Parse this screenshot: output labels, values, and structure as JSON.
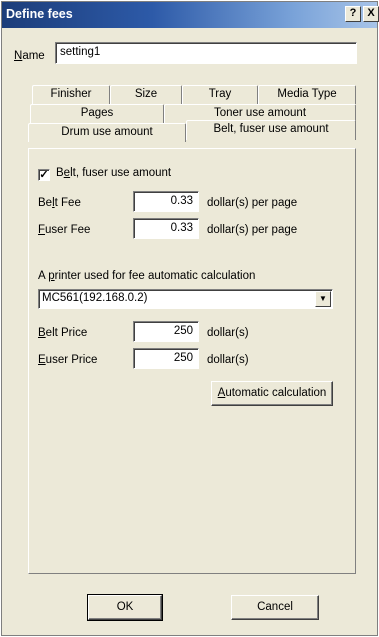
{
  "window": {
    "title": "Define fees",
    "help_label": "?",
    "close_label": "X"
  },
  "name_field": {
    "label_mnemonic": "N",
    "label_rest": "ame",
    "value": "setting1"
  },
  "tabs": {
    "row1": [
      "Finisher",
      "Size",
      "Tray",
      "Media Type"
    ],
    "row2": [
      "Pages",
      "Toner use amount"
    ],
    "row3": [
      "Drum use amount",
      "Belt, fuser use amount"
    ]
  },
  "belt_fuser": {
    "checkbox": {
      "checked_glyph": "✓",
      "mnemonic": "e",
      "pre": "B",
      "rest": "lt, fuser use amount"
    },
    "belt_fee": {
      "pre": "Be",
      "mnemonic": "l",
      "rest": "t Fee",
      "value": "0.33",
      "unit": "dollar(s) per page"
    },
    "fuser_fee": {
      "pre": "",
      "mnemonic": "F",
      "rest": "user Fee",
      "value": "0.33",
      "unit": "dollar(s) per page"
    },
    "printer_label": {
      "pre": "A ",
      "mnemonic": "p",
      "rest": "rinter used for fee automatic calculation"
    },
    "printer_select": {
      "value": "MC561(192.168.0.2)",
      "arrow": "▼"
    },
    "belt_price": {
      "pre": "",
      "mnemonic": "B",
      "rest": "elt Price",
      "value": "250",
      "unit": "dollar(s)"
    },
    "fuser_price": {
      "pre": "",
      "mnemonic": "E",
      "rest": "user Price",
      "value": "250",
      "unit": "dollar(s)"
    },
    "auto_button": {
      "mnemonic": "A",
      "rest": "utomatic calculation"
    }
  },
  "footer": {
    "ok_label": "OK",
    "cancel_label": "Cancel"
  }
}
